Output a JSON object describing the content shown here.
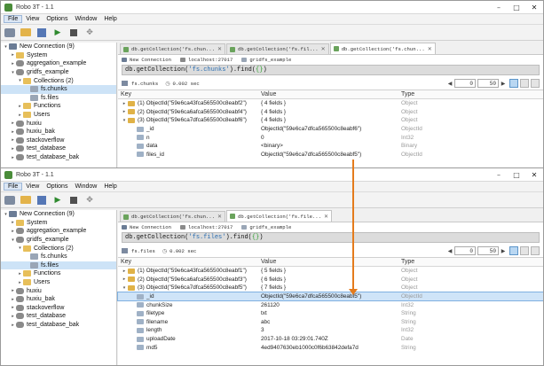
{
  "window1": {
    "title": "Robo 3T - 1.1",
    "menu": [
      "File",
      "View",
      "Options",
      "Window",
      "Help"
    ],
    "tree": [
      {
        "label": "New Connection (9)",
        "level": 0,
        "arrow": "▾",
        "icon": "server"
      },
      {
        "label": "System",
        "level": 1,
        "arrow": "▸",
        "icon": "folder"
      },
      {
        "label": "aggregation_example",
        "level": 1,
        "arrow": "▸",
        "icon": "db"
      },
      {
        "label": "gridfs_example",
        "level": 1,
        "arrow": "▾",
        "icon": "db"
      },
      {
        "label": "Collections (2)",
        "level": 2,
        "arrow": "▾",
        "icon": "folder"
      },
      {
        "label": "fs.chunks",
        "level": 3,
        "arrow": "",
        "icon": "coll",
        "selected": true
      },
      {
        "label": "fs.files",
        "level": 3,
        "arrow": "",
        "icon": "coll"
      },
      {
        "label": "Functions",
        "level": 2,
        "arrow": "▸",
        "icon": "folder"
      },
      {
        "label": "Users",
        "level": 2,
        "arrow": "▸",
        "icon": "folder"
      },
      {
        "label": "huxiu",
        "level": 1,
        "arrow": "▸",
        "icon": "db"
      },
      {
        "label": "huxiu_bak",
        "level": 1,
        "arrow": "▸",
        "icon": "db"
      },
      {
        "label": "stackoverflow",
        "level": 1,
        "arrow": "▸",
        "icon": "db"
      },
      {
        "label": "test_database",
        "level": 1,
        "arrow": "▸",
        "icon": "db"
      },
      {
        "label": "test_database_bak",
        "level": 1,
        "arrow": "▸",
        "icon": "db"
      }
    ],
    "tabs": [
      {
        "label": "db.getCollection('fs.chun...",
        "active": false
      },
      {
        "label": "db.getCollection('fs.fil...",
        "active": false
      },
      {
        "label": "db.getCollection('fs.chun...",
        "active": true
      }
    ],
    "conn": {
      "name": "New Connection",
      "host": "localhost:27017",
      "db": "gridfs_example"
    },
    "query": {
      "prefix": "db.getCollection(",
      "collection": "'fs.chunks'",
      "suffix": ").find(",
      "empty": "{}",
      "end": ")"
    },
    "result": {
      "collection": "fs.chunks",
      "time": "0.002 sec",
      "page_from": "0",
      "page_size": "50"
    },
    "headers": {
      "key": "Key",
      "value": "Value",
      "type": "Type"
    },
    "rows": [
      {
        "expander": "▸",
        "icon": "doc",
        "indent": 0,
        "key": "(1) ObjectId(\"59e6ca43fca565500c8eabf2\")",
        "value": "{ 4 fields }",
        "type": "Object"
      },
      {
        "expander": "▸",
        "icon": "doc",
        "indent": 0,
        "key": "(2) ObjectId(\"59e6ca6afca565500c8eabf4\")",
        "value": "{ 4 fields }",
        "type": "Object"
      },
      {
        "expander": "▾",
        "icon": "doc",
        "indent": 0,
        "key": "(3) ObjectId(\"59e6ca7dfca565500c8eabf6\")",
        "value": "{ 4 fields }",
        "type": "Object"
      },
      {
        "expander": "",
        "icon": "field",
        "indent": 1,
        "key": "_id",
        "value": "ObjectId(\"59e6ca7dfca565500c8eabf6\")",
        "type": "ObjectId"
      },
      {
        "expander": "",
        "icon": "field",
        "indent": 1,
        "key": "n",
        "value": "0",
        "type": "Int32"
      },
      {
        "expander": "",
        "icon": "field",
        "indent": 1,
        "key": "data",
        "value": "<binary>",
        "type": "Binary"
      },
      {
        "expander": "",
        "icon": "field",
        "indent": 1,
        "key": "files_id",
        "value": "ObjectId(\"59e6ca7dfca565500c8eabf5\")",
        "type": "ObjectId"
      }
    ]
  },
  "window2": {
    "title": "Robo 3T - 1.1",
    "menu": [
      "File",
      "View",
      "Options",
      "Window",
      "Help"
    ],
    "tree": [
      {
        "label": "New Connection (9)",
        "level": 0,
        "arrow": "▾",
        "icon": "server"
      },
      {
        "label": "System",
        "level": 1,
        "arrow": "▸",
        "icon": "folder"
      },
      {
        "label": "aggregation_example",
        "level": 1,
        "arrow": "▸",
        "icon": "db"
      },
      {
        "label": "gridfs_example",
        "level": 1,
        "arrow": "▾",
        "icon": "db"
      },
      {
        "label": "Collections (2)",
        "level": 2,
        "arrow": "▾",
        "icon": "folder"
      },
      {
        "label": "fs.chunks",
        "level": 3,
        "arrow": "",
        "icon": "coll"
      },
      {
        "label": "fs.files",
        "level": 3,
        "arrow": "",
        "icon": "coll",
        "selected": true
      },
      {
        "label": "Functions",
        "level": 2,
        "arrow": "▸",
        "icon": "folder"
      },
      {
        "label": "Users",
        "level": 2,
        "arrow": "▸",
        "icon": "folder"
      },
      {
        "label": "huxiu",
        "level": 1,
        "arrow": "▸",
        "icon": "db"
      },
      {
        "label": "huxiu_bak",
        "level": 1,
        "arrow": "▸",
        "icon": "db"
      },
      {
        "label": "stackoverflow",
        "level": 1,
        "arrow": "▸",
        "icon": "db"
      },
      {
        "label": "test_database",
        "level": 1,
        "arrow": "▸",
        "icon": "db"
      },
      {
        "label": "test_database_bak",
        "level": 1,
        "arrow": "▸",
        "icon": "db"
      }
    ],
    "tabs": [
      {
        "label": "db.getCollection('fs.chun...",
        "active": false
      },
      {
        "label": "db.getCollection('fs.file...",
        "active": true
      }
    ],
    "conn": {
      "name": "New Connection",
      "host": "localhost:27017",
      "db": "gridfs_example"
    },
    "query": {
      "prefix": "db.getCollection(",
      "collection": "'fs.files'",
      "suffix": ").find(",
      "empty": "{}",
      "end": ")"
    },
    "result": {
      "collection": "fs.files",
      "time": "0.002 sec",
      "page_from": "0",
      "page_size": "50"
    },
    "headers": {
      "key": "Key",
      "value": "Value",
      "type": "Type"
    },
    "rows": [
      {
        "expander": "▸",
        "icon": "doc",
        "indent": 0,
        "key": "(1) ObjectId(\"59e6ca43fca565500c8eabf1\")",
        "value": "{ 5 fields }",
        "type": "Object"
      },
      {
        "expander": "▸",
        "icon": "doc",
        "indent": 0,
        "key": "(2) ObjectId(\"59e6ca6afca565500c8eabf3\")",
        "value": "{ 6 fields }",
        "type": "Object"
      },
      {
        "expander": "▾",
        "icon": "doc",
        "indent": 0,
        "key": "(3) ObjectId(\"59e6ca7dfca565500c8eabf5\")",
        "value": "{ 7 fields }",
        "type": "Object"
      },
      {
        "expander": "",
        "icon": "field",
        "indent": 1,
        "key": "_id",
        "value": "ObjectId(\"59e6ca7dfca565500c8eabf5\")",
        "type": "ObjectId",
        "selected": true
      },
      {
        "expander": "",
        "icon": "field",
        "indent": 1,
        "key": "chunkSize",
        "value": "261120",
        "type": "Int32"
      },
      {
        "expander": "",
        "icon": "field",
        "indent": 1,
        "key": "filetype",
        "value": "txt",
        "type": "String"
      },
      {
        "expander": "",
        "icon": "field",
        "indent": 1,
        "key": "filename",
        "value": "abc",
        "type": "String"
      },
      {
        "expander": "",
        "icon": "field",
        "indent": 1,
        "key": "length",
        "value": "3",
        "type": "Int32"
      },
      {
        "expander": "",
        "icon": "field",
        "indent": 1,
        "key": "uploadDate",
        "value": "2017-10-18 03:29:01.740Z",
        "type": "Date"
      },
      {
        "expander": "",
        "icon": "field",
        "indent": 1,
        "key": "md5",
        "value": "4ed9407630eb1000c0f6b63842defa7d",
        "type": "String"
      }
    ]
  },
  "colors": {
    "connector": "#e47b1c",
    "selection": "#cfe4f8",
    "type_text": "#9a9a9a"
  }
}
